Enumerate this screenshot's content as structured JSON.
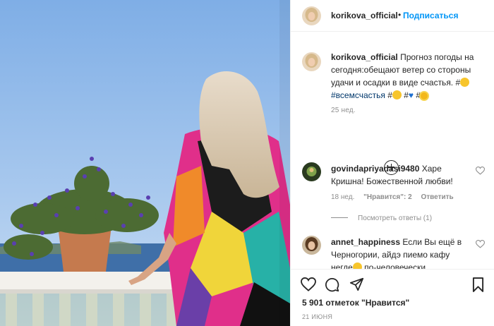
{
  "post": {
    "author": "korikova_official",
    "follow_label": "Подписаться",
    "dot": "•",
    "caption": {
      "author": "korikova_official",
      "text": "Прогноз погоды на сегодня:обещают ветер со стороны удачи и осадки в виде счастья. #",
      "hashtag": "#всемсчастья",
      "tail_1": " #",
      "tail_2": " #",
      "tail_3": " #",
      "time": "25 нед."
    },
    "comments": [
      {
        "author": "govindapriyadasi9480",
        "text": "Харе Кришна! Божественной любви!",
        "time": "18 нед.",
        "likes": "\"Нравится\": 2",
        "reply": "Ответить",
        "view_replies": "Посмотреть ответы (1)"
      },
      {
        "author": "annet_happiness",
        "text_1": "Если Вы ещё в Черногории, айдэ пиемо кафу негде",
        "text_2": " по-человечески"
      }
    ],
    "likes_text": "5 901 отметок \"Нравится\"",
    "date": "21 ИЮНЯ"
  },
  "icons": {
    "like": "heart-icon",
    "comment": "comment-icon",
    "share": "share-icon",
    "save": "bookmark-icon",
    "more_comments": "plus-circle-icon",
    "comment_like": "small-heart-icon"
  },
  "colors": {
    "link": "#0095f6",
    "hashtag": "#00376b",
    "muted": "#8e8e8e",
    "text": "#262626"
  }
}
